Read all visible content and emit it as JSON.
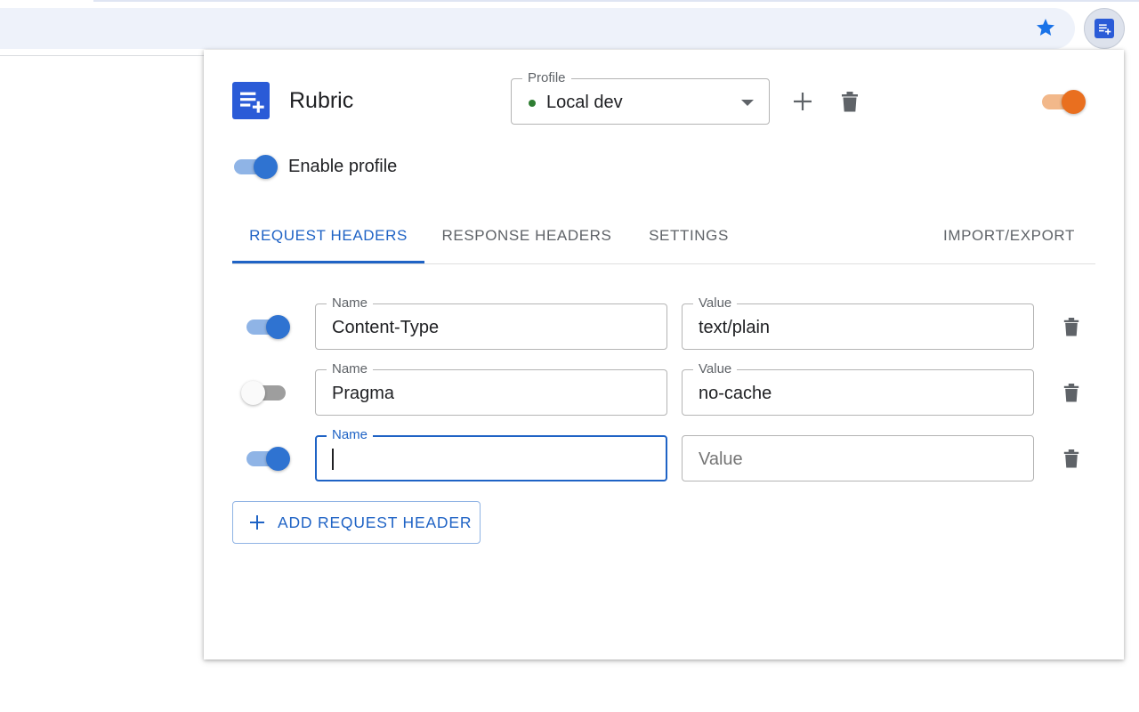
{
  "browser": {
    "bookmark_icon": "star-icon",
    "extension_icon": "rubric-extension-icon",
    "accent": "#1a73e8"
  },
  "app": {
    "title": "Rubric",
    "logo_icon": "playlist-add-icon",
    "brand_color": "#2a5bd7",
    "master_switch_on": true,
    "master_switch_color": "#e96f1f"
  },
  "profile": {
    "label": "Profile",
    "selected": "Local dev",
    "status_color": "#2e7d32",
    "add_icon": "plus-icon",
    "delete_icon": "trash-icon"
  },
  "enable_profile": {
    "label": "Enable profile",
    "on": true
  },
  "tabs": [
    {
      "label": "REQUEST HEADERS",
      "active": true
    },
    {
      "label": "RESPONSE HEADERS",
      "active": false
    },
    {
      "label": "SETTINGS",
      "active": false
    },
    {
      "label": "IMPORT/EXPORT",
      "active": false
    }
  ],
  "headers": [
    {
      "enabled": true,
      "name_label": "Name",
      "name": "Content-Type",
      "value_label": "Value",
      "value": "text/plain"
    },
    {
      "enabled": false,
      "name_label": "Name",
      "name": "Pragma",
      "value_label": "Value",
      "value": "no-cache"
    },
    {
      "enabled": true,
      "name_label": "Name",
      "name": "",
      "value_label": "",
      "value": "",
      "value_placeholder": "Value",
      "focused": true
    }
  ],
  "add_button": {
    "label": "ADD REQUEST HEADER",
    "icon": "plus-icon"
  },
  "colors": {
    "primary": "#1f63c5",
    "switch_track_on": "#8fb4e6",
    "switch_thumb_on": "#2f73d1"
  }
}
